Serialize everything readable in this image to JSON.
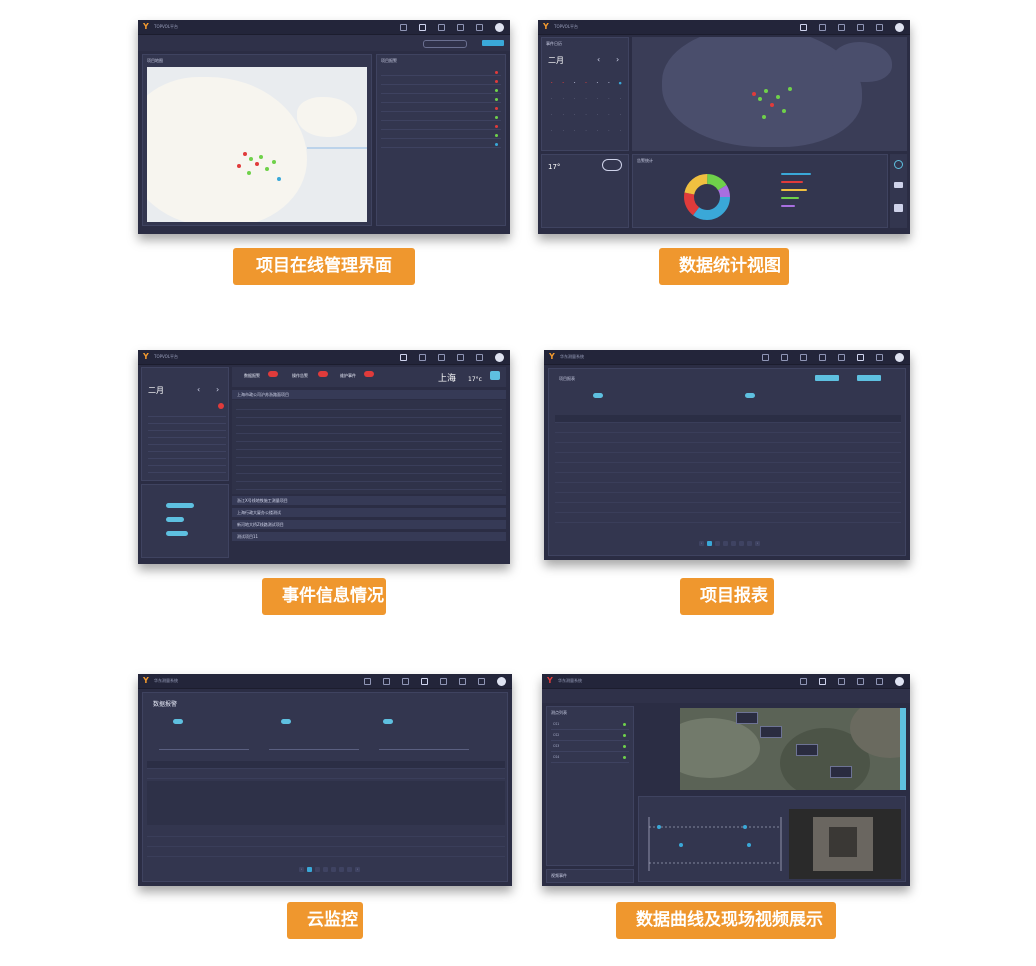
{
  "cards": [
    {
      "label": "项目在线管理界面",
      "app_title": "TOPVOL平台",
      "panel_left": "项目地图",
      "panel_right": "项目报警"
    },
    {
      "label": "数据统计视图",
      "app_title": "TOPVOL平台",
      "calendar_title": "事件日历",
      "month": "二月",
      "weather_temp": "17°",
      "chart_title": "告警统计"
    },
    {
      "label": "事件信息情况",
      "app_title": "TOPVOL平台",
      "month": "二月",
      "tab1": "数据报警",
      "tab2": "操作告警",
      "tab3": "维护事件",
      "city": "上海",
      "temp": "17°c",
      "accordion": [
        "上海市政公司沪苏浙路面项目",
        "浙江X号线地铁施工测量项目",
        "上海行政大厦办公楼测试",
        "新河地大桥Z线路测试项目",
        "测试项目11"
      ]
    },
    {
      "label": "项目报表",
      "app_title": "华东测量系统",
      "panel_title": "项目报表"
    },
    {
      "label": "云监控",
      "app_title": "华东测量系统",
      "panel_title": "数据报警"
    },
    {
      "label": "数据曲线及现场视频展示",
      "app_title": "华东测量系统",
      "panel_title": "测点列表",
      "points": [
        "CS1",
        "CS2",
        "CS3",
        "CS4"
      ],
      "bottom_label": "视频事件"
    }
  ],
  "colors": {
    "accent": "#ef972e",
    "panel": "#2b2d44",
    "topbar": "#23253a",
    "red": "#e03b3b",
    "green": "#6fd14a",
    "blue": "#3aa8d8"
  },
  "icons": {
    "logo": "Y"
  }
}
